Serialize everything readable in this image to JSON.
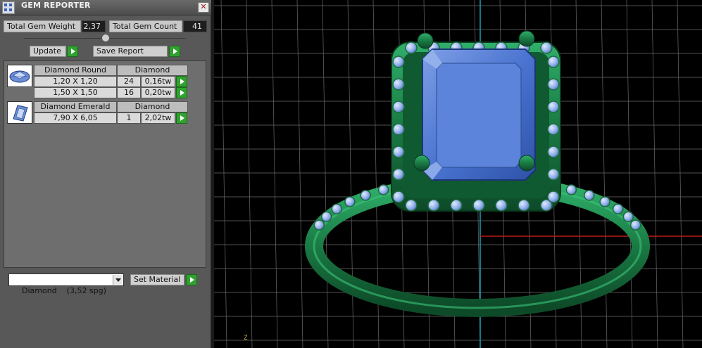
{
  "window": {
    "title": "GEM REPORTER",
    "close_symbol": "✕"
  },
  "summary": {
    "total_weight_label": "Total Gem Weight",
    "total_weight_value": "2,37",
    "total_count_label": "Total Gem Count",
    "total_count_value": "41"
  },
  "actions": {
    "update_label": "Update",
    "save_report_label": "Save Report"
  },
  "gem_groups": [
    {
      "shape": "Diamond Round",
      "material": "Diamond",
      "icon": "round-gem-icon",
      "rows": [
        {
          "size": "1,20 X 1,20",
          "count": "24",
          "weight": "0,16tw"
        },
        {
          "size": "1,50 X 1,50",
          "count": "16",
          "weight": "0,20tw"
        }
      ]
    },
    {
      "shape": "Diamond Emerald",
      "material": "Diamond",
      "icon": "emerald-cut-gem-icon",
      "rows": [
        {
          "size": "7,90 X 6,05",
          "count": "1",
          "weight": "2,02tw"
        }
      ]
    }
  ],
  "material": {
    "selected": "Diamond    (3,52 spg)",
    "set_material_label": "Set Material"
  },
  "viewport": {
    "axis_label": "Z",
    "colors": {
      "background": "#000000",
      "grid": "#6b6b6b",
      "metal": "#1f8a4d",
      "gem": "#4a78d4",
      "x_axis": "#c01818",
      "y_axis": "#1aa0b8"
    }
  },
  "colors": {
    "panel": "#585858",
    "go_button": "#2fa22f",
    "value_box": "#1e1e1e"
  }
}
